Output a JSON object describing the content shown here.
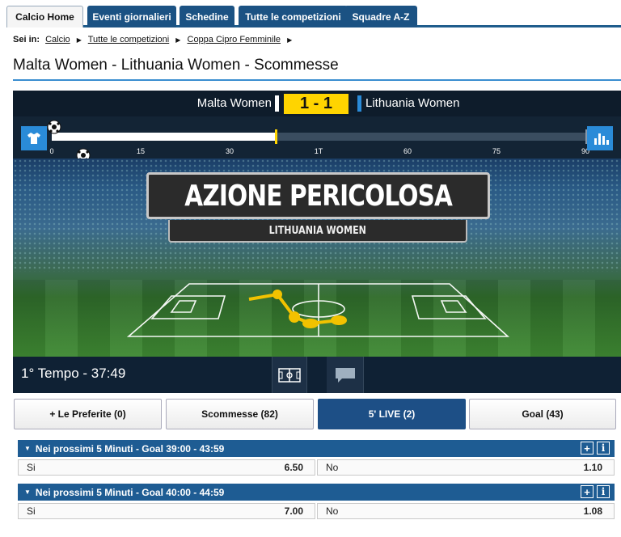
{
  "nav": {
    "tabs": [
      {
        "label": "Calcio Home"
      },
      {
        "label": "Eventi giornalieri"
      },
      {
        "label": "Schedine"
      },
      {
        "label": "Tutte le competizioni"
      },
      {
        "label": "Squadre A-Z"
      }
    ]
  },
  "breadcrumb": {
    "prefix": "Sei in:",
    "items": [
      "Calcio",
      "Tutte le competizioni",
      "Coppa Cipro Femminile"
    ]
  },
  "page_title": "Malta Women - Lithuania Women - Scommesse",
  "match": {
    "home": "Malta Women",
    "away": "Lithuania Women",
    "score": "1 - 1",
    "progress_minute": 37.8,
    "ticks": [
      "0",
      "15",
      "30",
      "1T",
      "60",
      "75",
      "90"
    ],
    "event_title": "AZIONE PERICOLOSA",
    "event_team": "LITHUANIA WOMEN",
    "period_clock": "1° Tempo - 37:49"
  },
  "colors": {
    "accent_blue": "#2a8bd8",
    "score_yellow": "#ffd400",
    "nav_blue": "#1b5283"
  },
  "filters": [
    {
      "label": "+ Le Preferite (0)"
    },
    {
      "label": "Scommesse (82)"
    },
    {
      "label": "5' LIVE (2)"
    },
    {
      "label": "Goal (43)"
    }
  ],
  "markets": [
    {
      "title": "Nei prossimi 5 Minuti - Goal 39:00 - 43:59",
      "options": [
        {
          "label": "Si",
          "odds": "6.50"
        },
        {
          "label": "No",
          "odds": "1.10"
        }
      ]
    },
    {
      "title": "Nei prossimi 5 Minuti - Goal 40:00 - 44:59",
      "options": [
        {
          "label": "Si",
          "odds": "7.00"
        },
        {
          "label": "No",
          "odds": "1.08"
        }
      ]
    }
  ]
}
